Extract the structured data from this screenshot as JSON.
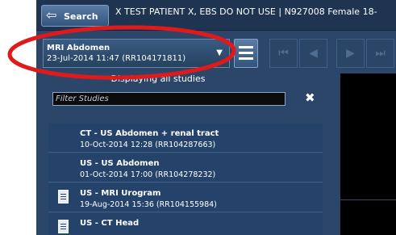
{
  "header": {
    "search_button_label": "Search",
    "back_glyph": "⇦",
    "patient_banner": "X TEST PATIENT X, EBS DO NOT USE | N927008 Female 18-"
  },
  "selected_study": {
    "title": "MRI Abdomen",
    "subtitle": "23-Jul-2014 11:47 (RR104171811)",
    "caret": "▼"
  },
  "navigation": {
    "first": "⏮",
    "prev": "◀",
    "next": "▶",
    "last": "⏭"
  },
  "displaying_text": "Displaying all studies",
  "filter": {
    "placeholder": "Filter Studies",
    "clear_glyph": "✖"
  },
  "studies": [
    {
      "title": "CT - US Abdomen + renal tract",
      "date": "10-Oct-2014 12:28 (RR104287663)",
      "has_report_icon": false
    },
    {
      "title": "US - US Abdomen",
      "date": "01-Oct-2014 17:00 (RR104278232)",
      "has_report_icon": false
    },
    {
      "title": "US - MRI Urogram",
      "date": "19-Aug-2014 15:36 (RR104155984)",
      "has_report_icon": true
    },
    {
      "title": "US - CT Head",
      "date": "",
      "has_report_icon": true
    }
  ],
  "scrollbar": {
    "up_glyph": "▲"
  },
  "colors": {
    "panel_background": "#2b4668",
    "list_item": "#25436a",
    "scroll_thumb": "#a9cfa2",
    "annotation": "#e0191b"
  }
}
